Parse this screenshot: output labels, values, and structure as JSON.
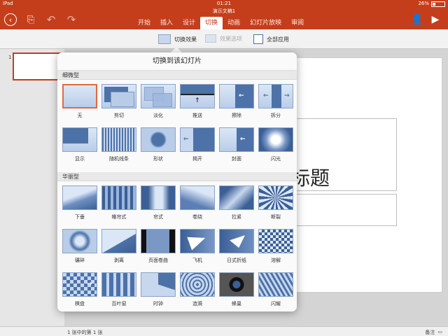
{
  "status": {
    "device": "iPad",
    "time": "01:21",
    "battery": "26%"
  },
  "document": {
    "title": "演示文稿1"
  },
  "icons": {
    "back": "back-circle-icon",
    "file": "file-icon",
    "undo": "undo-icon",
    "redo": "redo-icon",
    "share": "add-person-icon",
    "play": "play-icon"
  },
  "tabs": [
    "开始",
    "插入",
    "设计",
    "切换",
    "动画",
    "幻灯片放映",
    "审阅"
  ],
  "active_tab": "切换",
  "ribbon": {
    "effect": "切换效果",
    "options": "效果选项",
    "apply_all": "全部应用"
  },
  "thumbnails": {
    "number": "1"
  },
  "slide": {
    "title_text": "标题"
  },
  "popover": {
    "title": "切换到该幻灯片",
    "groups": [
      {
        "name": "细微型",
        "items": [
          "无",
          "剪切",
          "淡化",
          "推送",
          "擦除",
          "拆分",
          "显示",
          "随机线条",
          "形状",
          "揭开",
          "封面",
          "闪光"
        ]
      },
      {
        "name": "华丽型",
        "items": [
          "下垂",
          "帷帘式",
          "帘式",
          "卷绕",
          "拉紧",
          "断裂",
          "碾碎",
          "剥离",
          "页面卷曲",
          "飞机",
          "日式折纸",
          "溶解",
          "棋盘",
          "百叶窗",
          "时钟",
          "涟漪",
          "蜂巢",
          "闪耀"
        ]
      }
    ],
    "selected": "无"
  },
  "bottom": {
    "slide_count": "1 张中的第 1 张",
    "notes": "备注"
  },
  "colors": {
    "accent": "#c43e1c",
    "tile_blue": "#4d72a8",
    "selected_border": "#e06a3c"
  }
}
